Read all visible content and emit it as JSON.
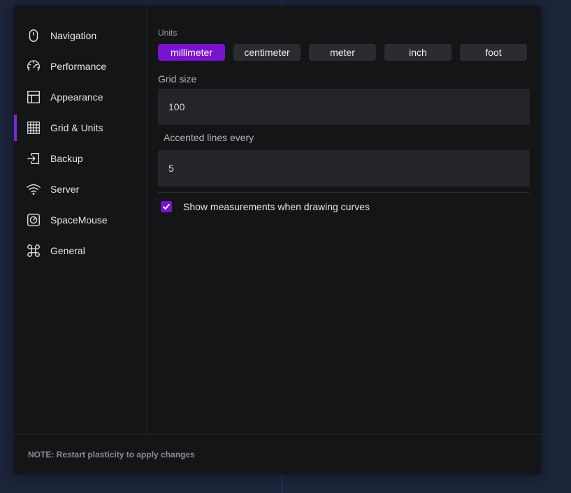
{
  "sidebar": {
    "items": [
      {
        "label": "Navigation",
        "icon": "mouse-icon",
        "active": false
      },
      {
        "label": "Performance",
        "icon": "speedometer-icon",
        "active": false
      },
      {
        "label": "Appearance",
        "icon": "layout-icon",
        "active": false
      },
      {
        "label": "Grid & Units",
        "icon": "grid-icon",
        "active": true
      },
      {
        "label": "Backup",
        "icon": "import-icon",
        "active": false
      },
      {
        "label": "Server",
        "icon": "wifi-icon",
        "active": false
      },
      {
        "label": "SpaceMouse",
        "icon": "spacemouse-icon",
        "active": false
      },
      {
        "label": "General",
        "icon": "command-icon",
        "active": false
      }
    ]
  },
  "units": {
    "label": "Units",
    "options": [
      "millimeter",
      "centimeter",
      "meter",
      "inch",
      "foot"
    ],
    "selected": "millimeter"
  },
  "grid_size": {
    "label": "Grid size",
    "value": "100"
  },
  "accented_lines": {
    "label": "Accented lines every",
    "value": "5"
  },
  "show_measurements": {
    "label": "Show measurements when drawing curves",
    "checked": true
  },
  "footer": {
    "note": "NOTE: Restart plasticity to apply changes"
  },
  "colors": {
    "accent": "#7a12d2",
    "background": "#1b2438",
    "panel": "#141517"
  }
}
